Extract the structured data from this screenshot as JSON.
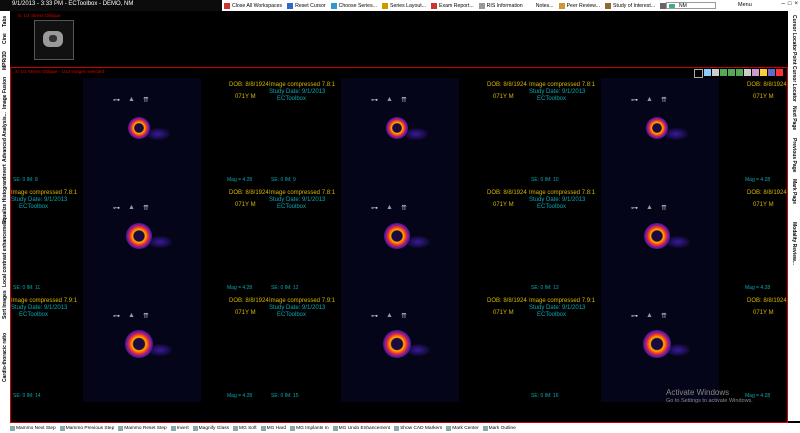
{
  "titlebar": {
    "app_title": "9/1/2013 - 3:33 PM - ECToolbox - DEMO, NM",
    "tools": [
      {
        "label": "Close All Workspaces",
        "icon": "close-workspaces-icon",
        "color": "#c33"
      },
      {
        "label": "Reset Cursor",
        "icon": "cursor-icon",
        "color": "#36c"
      },
      {
        "label": "Choose Series...",
        "icon": "series-icon",
        "color": "#39c"
      },
      {
        "label": "Series Layout...",
        "icon": "layout-icon",
        "color": "#c90"
      },
      {
        "label": "Exam Report...",
        "icon": "report-icon",
        "color": "#c33"
      },
      {
        "label": "RIS Information",
        "icon": "ris-icon",
        "color": "#999"
      },
      {
        "label": "Notes...",
        "icon": "notes-icon",
        "color": "#fff"
      },
      {
        "label": "Peer Review...",
        "icon": "peer-review-icon",
        "color": "#c93"
      },
      {
        "label": "Study of Interest...",
        "icon": "study-icon",
        "color": "#963"
      },
      {
        "label": "Print...",
        "icon": "print-icon",
        "color": "#666"
      }
    ],
    "user": "NM",
    "menu": "Menu",
    "win_controls": [
      "–",
      "□",
      "×"
    ]
  },
  "left_tabs": [
    "Tabs",
    "Cine",
    "MPR/3D",
    "Image Fusion",
    "Advanced Analysis...",
    "Invert",
    "Equalize Histogram",
    "Local contrast enhancement",
    "Sort Images",
    "Cardio-thoracic ratio"
  ],
  "right_tabs": [
    "Cursor Locator",
    "Point Cursor Locator",
    "Next Page",
    "Previous Page",
    "Mark Page",
    "Modality Review..."
  ],
  "thumbnail": {
    "label": "S: 1/1 Stress Oblique"
  },
  "viewer": {
    "series_label": "S: 1/1 Stress Oblique - 1/12 images selected"
  },
  "cells": [
    {
      "id": "c1",
      "tl": "",
      "tl2": "",
      "tl3": "",
      "tr": "DOB: 8/8/1924",
      "tr2": "071Y M",
      "bl": "",
      "br": "",
      "icons": [
        "key",
        "triangle",
        "scissors"
      ]
    },
    {
      "id": "c2",
      "tl": "Image compressed 7.8:1",
      "tl2": "Study Date: 9/1/2013",
      "tl3": "ECToolbox",
      "tr": "DOB: 8/8/1924",
      "tr2": "071Y M",
      "bl": "",
      "br": "",
      "icons": [
        "key",
        "triangle",
        "scissors"
      ]
    },
    {
      "id": "c3",
      "tl": "Image compressed 7.8:1",
      "tl2": "Study Date: 9/1/2013",
      "tl3": "ECToolbox",
      "tr": "DOB: 8/8/1924",
      "tr2": "071Y M",
      "bl": "",
      "br": "",
      "icons": [
        "key",
        "triangle",
        "scissors"
      ]
    },
    {
      "id": "c4",
      "tl": "Image compressed 7.8:1",
      "tl2": "Study Date: 9/1/2013",
      "tl3": "ECToolbox",
      "tr": "",
      "tr2": "",
      "bl": "",
      "br": "",
      "icons": []
    }
  ],
  "row_labels": [
    {
      "se_im_1": "SE: 0 IM: 8",
      "mag_1": "Mag = 4.28",
      "se_im_2": "SE: 0 IM: 9",
      "se_im_3": "SE: 0 IM: 10",
      "mag_3": "Mag = 4.28"
    },
    {
      "se_im_1": "SE: 0 IM: 11",
      "mag_1": "Mag = 4.28",
      "se_im_2": "SE: 0 IM: 12",
      "se_im_3": "SE: 0 IM: 13",
      "mag_3": "Mag = 4.28"
    },
    {
      "se_im_1": "SE: 0 IM: 14",
      "mag_1": "Mag = 4.28",
      "se_im_2": "SE: 0 IM: 15",
      "se_im_3": "SE: 0 IM: 16",
      "mag_3": "Mag = 4.28"
    }
  ],
  "overlay": {
    "img_compressed": "Image compressed 7.8:1",
    "study_date": "Study Date: 9/1/2013",
    "ectoolbox": "ECToolbox",
    "dob": "DOB: 8/8/1924",
    "age_sex": "071Y M",
    "mag": "Mag = 4.28",
    "img_compressed_short": "Image compressed 7.9:1"
  },
  "statusbar": [
    {
      "label": "Mammo Next Step",
      "icon": "next-step-icon"
    },
    {
      "label": "Mammo Previous Step",
      "icon": "prev-step-icon"
    },
    {
      "label": "Mammo Reset Step",
      "icon": "reset-step-icon"
    },
    {
      "label": "Invert",
      "icon": "invert-icon"
    },
    {
      "label": "Magnify Glass",
      "icon": "magnify-icon"
    },
    {
      "label": "MG Soft",
      "icon": "mg-soft-icon"
    },
    {
      "label": "MG Hard",
      "icon": "mg-hard-icon"
    },
    {
      "label": "MG Implants In",
      "icon": "mg-implants-icon"
    },
    {
      "label": "MG Undo Enhancement",
      "icon": "mg-undo-icon"
    },
    {
      "label": "Show CAD Markers",
      "icon": "cad-icon"
    },
    {
      "label": "Mark Center",
      "icon": "mark-center-icon"
    },
    {
      "label": "Mark Outline",
      "icon": "mark-outline-icon"
    }
  ],
  "watermark": {
    "title": "Activate Windows",
    "sub": "Go to Settings to activate Windows."
  },
  "colors": {
    "accent_red": "#cc0000",
    "overlay_yellow": "#d8b800",
    "overlay_cyan": "#0aa7b0"
  }
}
